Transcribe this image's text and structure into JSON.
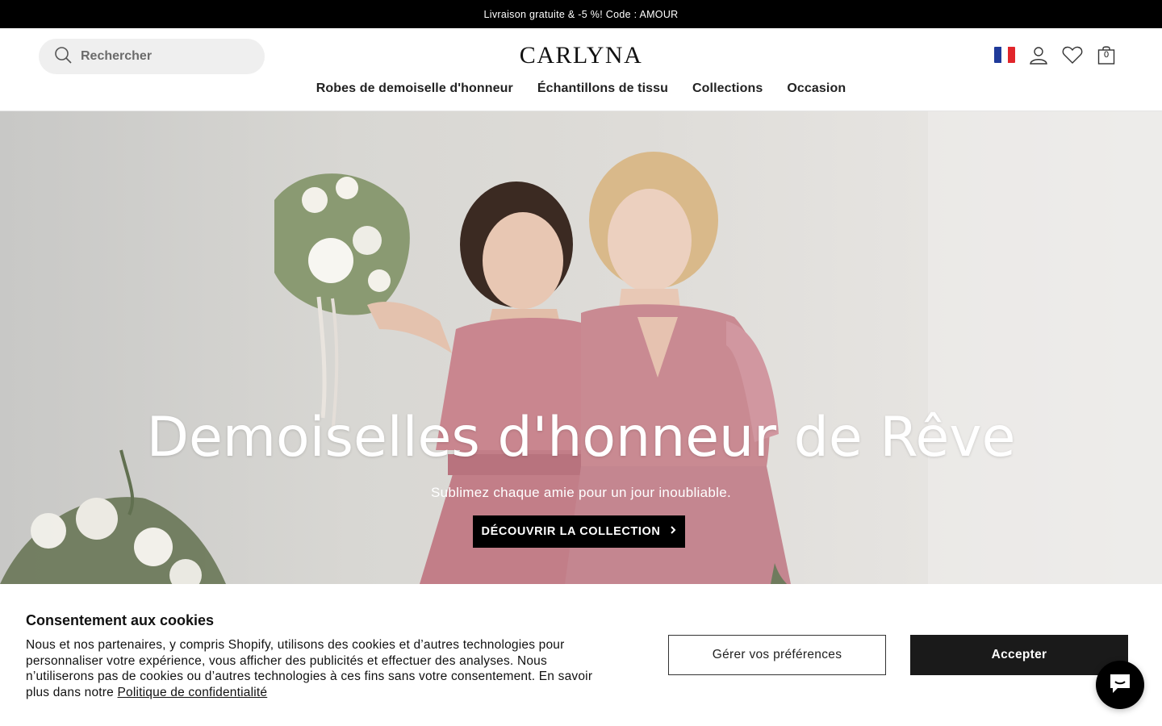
{
  "announcement": {
    "text": "Livraison gratuite & -5 %! Code : AMOUR"
  },
  "header": {
    "search_placeholder": "Rechercher",
    "logo": "CARLYNA",
    "cart_count": "0",
    "icons": [
      "france-flag-icon",
      "account-icon",
      "wishlist-heart-icon",
      "cart-bag-icon"
    ]
  },
  "nav": {
    "items": [
      {
        "label": "Robes de demoiselle d'honneur"
      },
      {
        "label": "Échantillons de tissu"
      },
      {
        "label": "Collections"
      },
      {
        "label": "Occasion"
      }
    ]
  },
  "hero": {
    "title": "Demoiselles d'honneur de Rêve",
    "subtitle": "Sublimez chaque amie pour un jour inoubliable.",
    "cta_label": "DÉCOUVRIR LA COLLECTION"
  },
  "cookie": {
    "title": "Consentement aux cookies",
    "text": "Nous et nos partenaires, y compris Shopify, utilisons des cookies et d’autres technologies pour personnaliser votre expérience, vous afficher des publicités et effectuer des analyses. Nous n’utiliserons pas de cookies ou d’autres technologies à ces fins sans votre consentement. En savoir plus dans notre",
    "link_label": "Politique de confidentialité",
    "prefs_label": "Gérer vos préférences",
    "accept_label": "Accepter"
  },
  "colors": {
    "announcement_bg": "#000000",
    "dress_pink": "#c9868f",
    "button_dark": "#1a1a1a"
  }
}
